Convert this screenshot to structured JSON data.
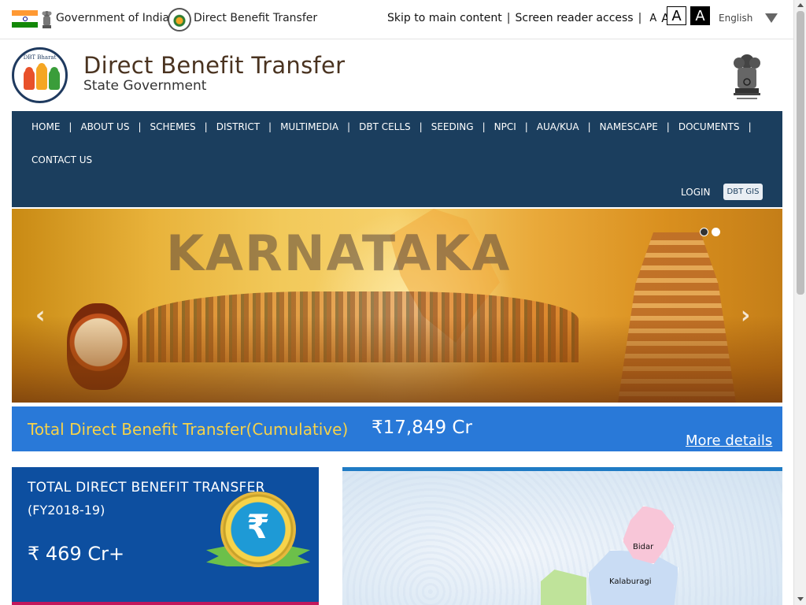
{
  "topbar": {
    "goi_label": "Government of India",
    "dbt_label": "Direct Benefit Transfer",
    "skip_link": "Skip to main content",
    "screen_reader": "Screen reader access",
    "font_small": "A",
    "font_medium": "A",
    "font_large": "A",
    "contrast_light": "A",
    "contrast_dark": "A",
    "language": "English",
    "separator": "|"
  },
  "header": {
    "title": "Direct Benefit Transfer",
    "subtitle": "State Government",
    "logo_text": "DBT Bharat"
  },
  "nav": {
    "items": [
      "HOME",
      "ABOUT US",
      "SCHEMES",
      "DISTRICT",
      "MULTIMEDIA",
      "DBT CELLS",
      "SEEDING",
      "NPCI",
      "AUA/KUA",
      "NAMESCAPE",
      "DOCUMENTS"
    ],
    "contact": "CONTACT US",
    "login": "LOGIN",
    "gis": "DBT GIS",
    "separator": "|"
  },
  "hero": {
    "title": "KARNATAKA",
    "prev": "‹",
    "next": "›",
    "active_slide": 1,
    "slide_count": 2
  },
  "cumulative": {
    "label": "Total Direct Benefit Transfer(Cumulative)",
    "value": "₹17,849 Cr",
    "more": "More details"
  },
  "card": {
    "title": "TOTAL DIRECT BENEFIT TRANSFER",
    "fy": "(FY2018-19)",
    "value": "₹ 469 Cr+",
    "medal_symbol": "₹"
  },
  "map": {
    "regions": [
      {
        "name": "Bidar",
        "color": "#f8c6d8"
      },
      {
        "name": "Kalaburagi",
        "color": "#c9dcf4"
      }
    ]
  },
  "colors": {
    "nav_bg": "#1b3e5e",
    "band_bg": "#2979d8",
    "band_label": "#f5d24a",
    "card_bg": "#0d4fa0",
    "title_brown": "#4a3320"
  }
}
